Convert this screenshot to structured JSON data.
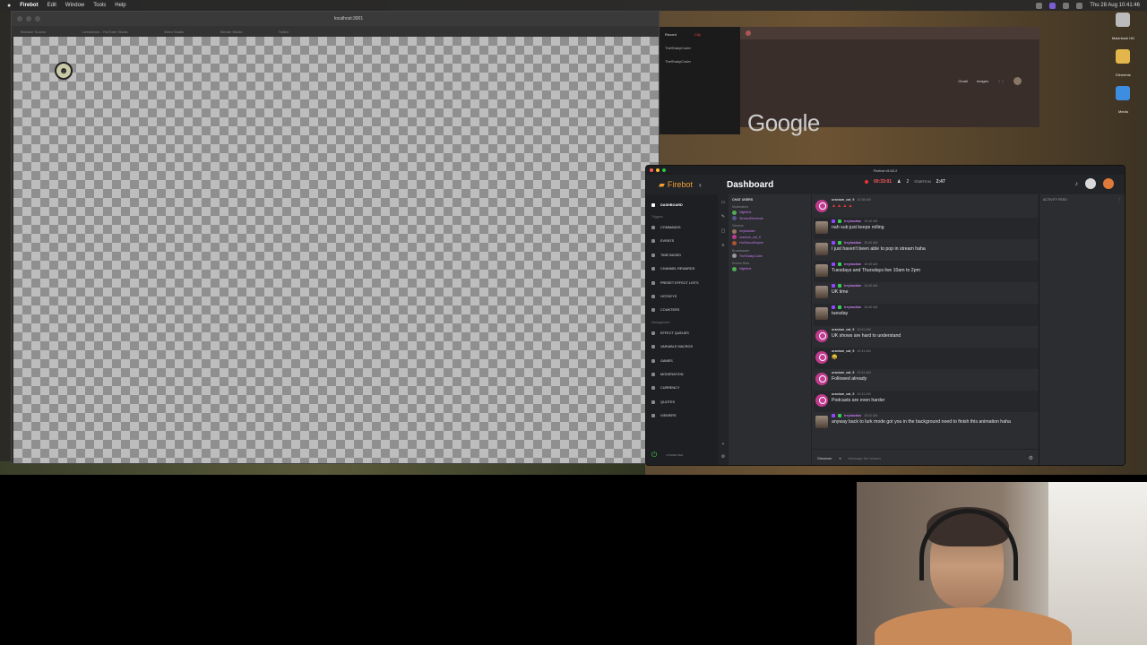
{
  "menubar": {
    "app": "Firebot",
    "items": [
      "Edit",
      "Window",
      "Tools",
      "Help"
    ],
    "clock": "Thu 28 Aug 10:41:46"
  },
  "browser": {
    "url": "localhost:3001",
    "tabs": [
      "Browser Source",
      "Livestream - YouTube Studio",
      "Video Studio",
      "Stream Studio",
      "Twitch"
    ]
  },
  "obs": {
    "tabs": [
      "Record",
      "Clip"
    ],
    "rows": [
      "TheShakyCoder",
      "TheShakyCoder"
    ]
  },
  "google": {
    "logo": "Google",
    "links": [
      "Gmail",
      "Images"
    ]
  },
  "desktop_icons": [
    "Macintosh HD",
    "Elements",
    "Media"
  ],
  "firebot": {
    "window_title": "Firebot v5.63.2",
    "brand": "Firebot",
    "page_title": "Dashboard",
    "stream_timer": "00:33:01",
    "viewer_count": "2",
    "starts_in_label": "STARTS IN",
    "starts_in_value": "2:47",
    "sidebar": {
      "group_triggers": "Triggers",
      "group_management": "Management",
      "items_top": [
        "DASHBOARD"
      ],
      "items_triggers": [
        "COMMANDS",
        "EVENTS",
        "TIME BASED",
        "CHANNEL REWARDS",
        "PRESET EFFECT LISTS",
        "HOTKEYS",
        "COUNTERS"
      ],
      "items_management": [
        "EFFECT QUEUES",
        "VARIABLE MACROS",
        "GAMES",
        "MODERATION",
        "CURRENCY",
        "QUOTES",
        "VIEWERS"
      ],
      "footer_status": "CONNECTED"
    },
    "users": {
      "header": "CHAT USERS",
      "groups": [
        {
          "label": "Moderators",
          "users": [
            "Nightbot",
            "StreamElements"
          ]
        },
        {
          "label": "Viewers",
          "users": [
            "treybastian",
            "uranium_cat_9",
            "HotSauceEmpire"
          ]
        },
        {
          "label": "Broadcaster",
          "users": [
            "TheShakyCoder"
          ]
        },
        {
          "label": "Known Bots",
          "users": [
            "Nightbot"
          ]
        }
      ]
    },
    "chat": {
      "messages": [
        {
          "user": "uranium_cat_9",
          "time": "10:38 AM",
          "text": "▲▲▲▲",
          "kind": "pink"
        },
        {
          "user": "treybastian",
          "time": "10:40 AM",
          "text": "nah sub just keeps rolling",
          "kind": "photo"
        },
        {
          "user": "treybastian",
          "time": "10:40 AM",
          "text": "I just haven't been able to pop in stream haha",
          "kind": "photo"
        },
        {
          "user": "treybastian",
          "time": "10:40 AM",
          "text": "Tuesdays and Thursdays live 10am to 2pm",
          "kind": "photo"
        },
        {
          "user": "treybastian",
          "time": "10:40 AM",
          "text": "UK time",
          "kind": "photo"
        },
        {
          "user": "treybastian",
          "time": "10:40 AM",
          "text": "tuesday",
          "kind": "photo"
        },
        {
          "user": "uranium_cat_9",
          "time": "10:41 AM",
          "text": "UK shows are hard to understand",
          "kind": "pink"
        },
        {
          "user": "uranium_cat_9",
          "time": "10:41 AM",
          "text": "😄",
          "kind": "pink"
        },
        {
          "user": "uranium_cat_9",
          "time": "10:41 AM",
          "text": "Followed already",
          "kind": "pink"
        },
        {
          "user": "uranium_cat_9",
          "time": "10:41 AM",
          "text": "Podcasts are even harder",
          "kind": "pink"
        },
        {
          "user": "treybastian",
          "time": "10:41 AM",
          "text": "anyway back to lurk mode got you in the background need to finish this animation haha",
          "kind": "photo"
        }
      ],
      "chat_as": "Streamer",
      "input_placeholder": "Message the stream"
    },
    "activity": {
      "header": "ACTIVITY FEED"
    }
  },
  "colors": {
    "firebot_orange": "#f2a033",
    "timer_red": "#ff5b5b",
    "twitch_purple": "#c47ae8",
    "connected_green": "#3ccc55"
  }
}
